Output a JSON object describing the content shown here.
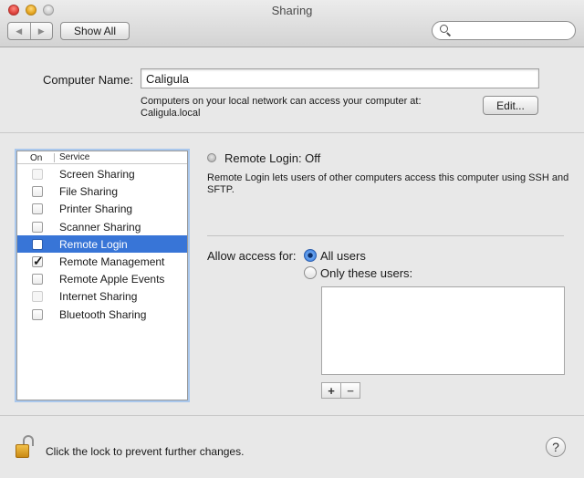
{
  "window": {
    "title": "Sharing"
  },
  "toolbar": {
    "back_glyph": "◀",
    "forward_glyph": "▶",
    "show_all_label": "Show All",
    "search_placeholder": ""
  },
  "computer_name": {
    "label": "Computer Name:",
    "value": "Caligula",
    "info_line1": "Computers on your local network can access your computer at:",
    "info_line2": "Caligula.local",
    "edit_label": "Edit..."
  },
  "services": {
    "header_on": "On",
    "header_service": "Service",
    "items": [
      {
        "name": "Screen Sharing",
        "checked": false,
        "dim": true,
        "selected": false
      },
      {
        "name": "File Sharing",
        "checked": false,
        "dim": false,
        "selected": false
      },
      {
        "name": "Printer Sharing",
        "checked": false,
        "dim": false,
        "selected": false
      },
      {
        "name": "Scanner Sharing",
        "checked": false,
        "dim": false,
        "selected": false
      },
      {
        "name": "Remote Login",
        "checked": false,
        "dim": false,
        "selected": true
      },
      {
        "name": "Remote Management",
        "checked": true,
        "dim": false,
        "selected": false
      },
      {
        "name": "Remote Apple Events",
        "checked": false,
        "dim": false,
        "selected": false
      },
      {
        "name": "Internet Sharing",
        "checked": false,
        "dim": true,
        "selected": false
      },
      {
        "name": "Bluetooth Sharing",
        "checked": false,
        "dim": false,
        "selected": false
      }
    ]
  },
  "detail": {
    "status": "Remote Login: Off",
    "description": "Remote Login lets users of other computers access this computer using SSH and SFTP.",
    "allow_label": "Allow access for:",
    "option_all": "All users",
    "option_only": "Only these users:",
    "selected_option": "all",
    "add_glyph": "+",
    "remove_glyph": "−"
  },
  "footer": {
    "lock_text": "Click the lock to prevent further changes.",
    "help_glyph": "?"
  },
  "colors": {
    "selection": "#3875d7",
    "focus_ring": "#a9c7ec"
  }
}
